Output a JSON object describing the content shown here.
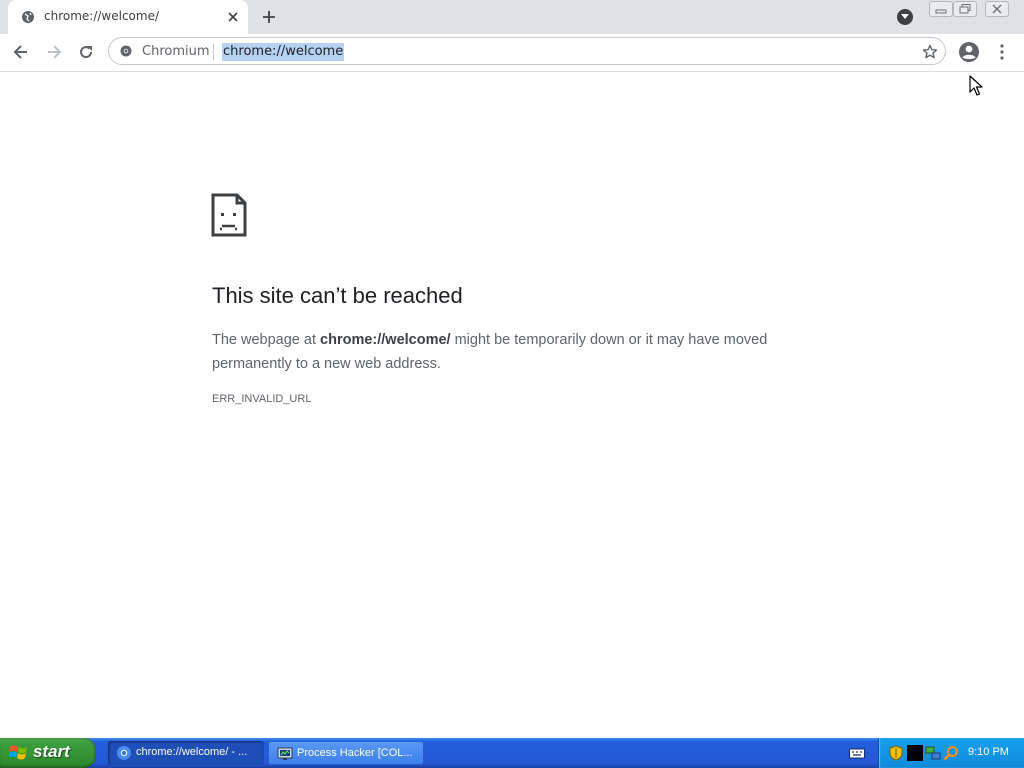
{
  "browser": {
    "tab": {
      "title": "chrome://welcome/"
    },
    "omnibox": {
      "origin_label": "Chromium",
      "url_text": "chrome://welcome"
    }
  },
  "error_page": {
    "title": "This site can’t be reached",
    "desc_prefix": "The webpage at ",
    "desc_url": "chrome://welcome/",
    "desc_suffix": " might be temporarily down or it may have moved permanently to a new web address.",
    "error_code": "ERR_INVALID_URL"
  },
  "taskbar": {
    "start_label": "start",
    "tasks": [
      {
        "label": "chrome://welcome/ - ..."
      },
      {
        "label": "Process Hacker [COL..."
      }
    ],
    "clock": "9:10 PM"
  },
  "colors": {
    "tab_strip": "#dee1e6",
    "url_highlight": "#b5d2f5",
    "taskbar_blue": "#245edb",
    "start_green": "#3c9d3c",
    "tray_blue": "#0f8ad9"
  },
  "icons": {
    "tab_favicon": "globe-icon",
    "tab_close": "close-icon",
    "new_tab": "plus-icon",
    "tab_search": "chevron-down-icon",
    "back": "arrow-left-icon",
    "forward": "arrow-right-icon",
    "reload": "reload-icon",
    "secure": "chromium-icon",
    "bookmark": "star-icon",
    "profile": "avatar-icon",
    "menu": "kebab-menu-icon",
    "error": "sad-document-icon"
  }
}
